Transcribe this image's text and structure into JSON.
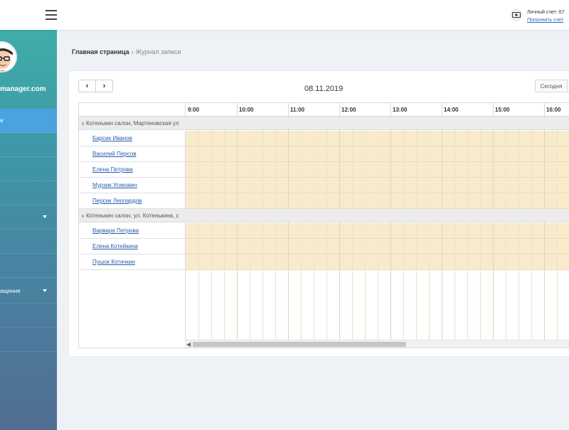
{
  "user": {
    "email": "manager.com"
  },
  "sidebar": {
    "items": [
      {
        "label": "и",
        "active": true
      },
      {
        "label": ""
      },
      {
        "label": ""
      },
      {
        "label": ""
      },
      {
        "label": ""
      },
      {
        "label": ""
      },
      {
        "label": ""
      },
      {
        "label": "ащения"
      },
      {
        "label": ""
      },
      {
        "label": ""
      }
    ]
  },
  "account": {
    "label": "Личный счет: 67",
    "topup_link": "Пополнить счет"
  },
  "breadcrumb": {
    "home": "Главная страница",
    "separator": "›",
    "current": "Журнал записи"
  },
  "toolbar": {
    "prev": "‹",
    "next": "›",
    "date": "08.11.2019",
    "today": "Сегодня"
  },
  "times": [
    "9:00",
    "10:00",
    "11:00",
    "12:00",
    "13:00",
    "14:00",
    "15:00",
    "16:00"
  ],
  "groups": [
    {
      "name": "Котенькин салон, Мартеновская ул",
      "resources": [
        "Барсик Иванов",
        "Василий Персов",
        "Елена Петрова",
        "Мурзик Усикович",
        "Персик Леопардов"
      ]
    },
    {
      "name": "Котенькин салон, ул. Котенькина, с",
      "resources": [
        "Варвара Петрова",
        "Елена Котейкина",
        "Пушок Котичкин"
      ]
    }
  ],
  "colors": {
    "accent": "#4aa3de",
    "slot": "#f8ebcc",
    "link": "#2a5da8"
  }
}
